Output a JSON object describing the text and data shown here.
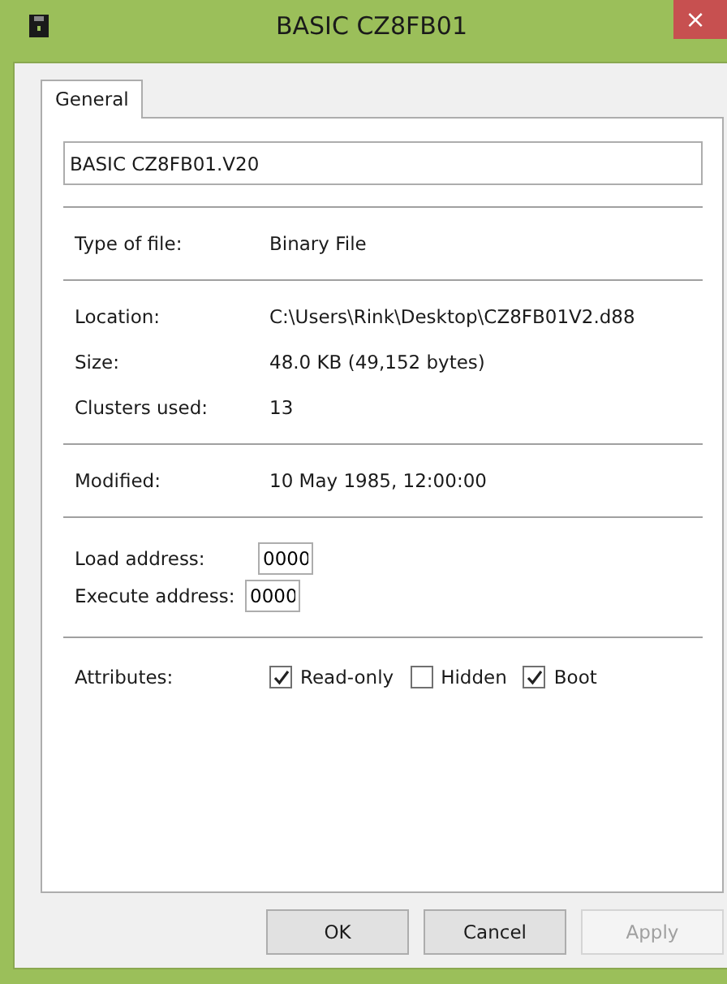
{
  "window": {
    "title": "BASIC CZ8FB01",
    "close": "×"
  },
  "tabs": [
    {
      "label": "General",
      "selected": true
    }
  ],
  "name_field": {
    "value": "BASIC CZ8FB01.V20"
  },
  "sections": [
    {
      "rows": [
        {
          "label": "Type of file:",
          "value": "Binary File"
        }
      ]
    },
    {
      "rows": [
        {
          "label": "Location:",
          "value": "C:\\Users\\Rink\\Desktop\\CZ8FB01V2.d88"
        },
        {
          "label": "Size:",
          "value": "48.0 KB (49,152 bytes)"
        },
        {
          "label": "Clusters used:",
          "value": "13"
        }
      ]
    },
    {
      "rows": [
        {
          "label": "Modified:",
          "value": "10 May 1985, 12:00:00"
        }
      ]
    }
  ],
  "addresses": [
    {
      "label": "Load address:",
      "value": "0000"
    },
    {
      "label": "Execute address:",
      "value": "0000"
    }
  ],
  "attributes": {
    "label": "Attributes:",
    "items": [
      {
        "label": "Read-only",
        "checked": true
      },
      {
        "label": "Hidden",
        "checked": false
      },
      {
        "label": "Boot",
        "checked": true
      }
    ]
  },
  "buttons": [
    {
      "label": "OK",
      "disabled": false
    },
    {
      "label": "Cancel",
      "disabled": false
    },
    {
      "label": "Apply",
      "disabled": true
    }
  ]
}
